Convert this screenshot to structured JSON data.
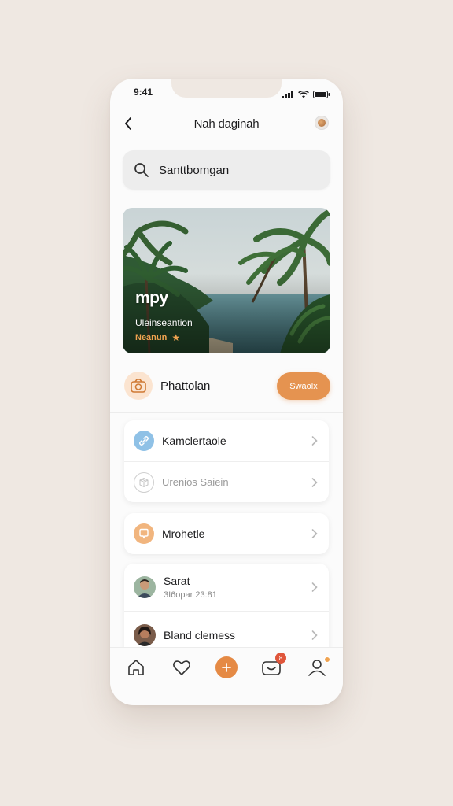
{
  "status": {
    "time": "9:41"
  },
  "nav": {
    "title": "Nah daginah"
  },
  "search": {
    "text": "Santtbomgan"
  },
  "hero": {
    "title": "mpy",
    "subtitle": "Uleinseantion",
    "rating_label": "Neanun",
    "rating_icon": "star-icon"
  },
  "photo_row": {
    "label": "Phattolan",
    "button": "Swaolx"
  },
  "settings_group": [
    {
      "label": "Kamclertaole",
      "icon": "link-icon",
      "icon_color": "#8fc1e6"
    },
    {
      "label": "Urenios Saiein",
      "icon": "box-icon",
      "icon_color": "#cfcfcf",
      "muted": true
    }
  ],
  "single_item": {
    "label": "Mrohetle",
    "icon": "chat-icon",
    "icon_color": "#f1b57e"
  },
  "messages": [
    {
      "name": "Sarat",
      "sub": "3I6opar 23:81"
    },
    {
      "name": "Bland clemess",
      "sub": ""
    }
  ],
  "tabbar": {
    "items": [
      "home-icon",
      "heart-icon",
      "plus-icon",
      "inbox-icon",
      "profile-icon"
    ],
    "badge": "8"
  },
  "colors": {
    "accent": "#e59350",
    "background": "#efe8e2",
    "badge": "#e0563b"
  }
}
